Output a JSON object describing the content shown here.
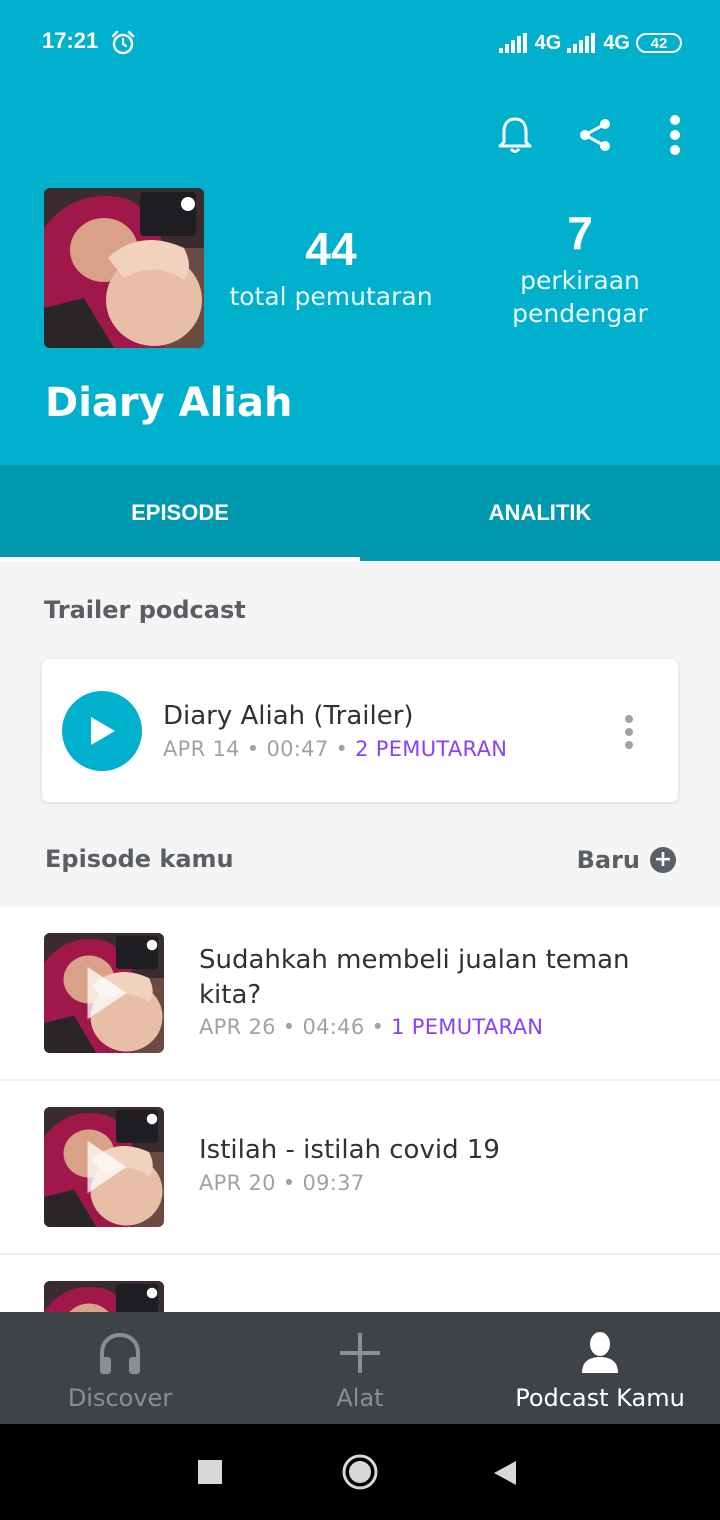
{
  "status_bar": {
    "time": "17:21",
    "network_1": "4G",
    "network_2": "4G",
    "battery": "42"
  },
  "header": {
    "podcast_name": "Diary Aliah",
    "stats": [
      {
        "value": "44",
        "label_line1": "total pemutaran",
        "label_line2": ""
      },
      {
        "value": "7",
        "label_line1": "perkiraan",
        "label_line2": "pendengar"
      }
    ],
    "actions": [
      "bell-icon",
      "share-icon",
      "more-vert-icon"
    ]
  },
  "tabs": [
    {
      "label": "EPISODE",
      "active": true
    },
    {
      "label": "ANALITIK",
      "active": false
    }
  ],
  "trailer_section": {
    "title": "Trailer podcast",
    "episode": {
      "title": "Diary Aliah (Trailer)",
      "date": "APR 14",
      "duration": "00:47",
      "plays": "2 PEMUTARAN"
    }
  },
  "episodes_section": {
    "title": "Episode kamu",
    "new_label": "Baru",
    "episodes": [
      {
        "title": "Sudahkah membeli jualan teman kita?",
        "date": "APR 26",
        "duration": "04:46",
        "plays": "1 PEMUTARAN"
      },
      {
        "title": "Istilah - istilah covid 19",
        "date": "APR 20",
        "duration": "09:37",
        "plays": ""
      }
    ]
  },
  "bottom_nav": [
    {
      "label": "Discover",
      "icon": "headphones-icon",
      "active": false
    },
    {
      "label": "Alat",
      "icon": "plus-icon",
      "active": false
    },
    {
      "label": "Podcast Kamu",
      "icon": "person-icon",
      "active": true
    }
  ],
  "colors": {
    "header_bg": "#00b0cc",
    "tab_bg": "#0099b0",
    "plays_accent": "#8a3ffc",
    "bottom_nav_bg": "#3f4247"
  }
}
